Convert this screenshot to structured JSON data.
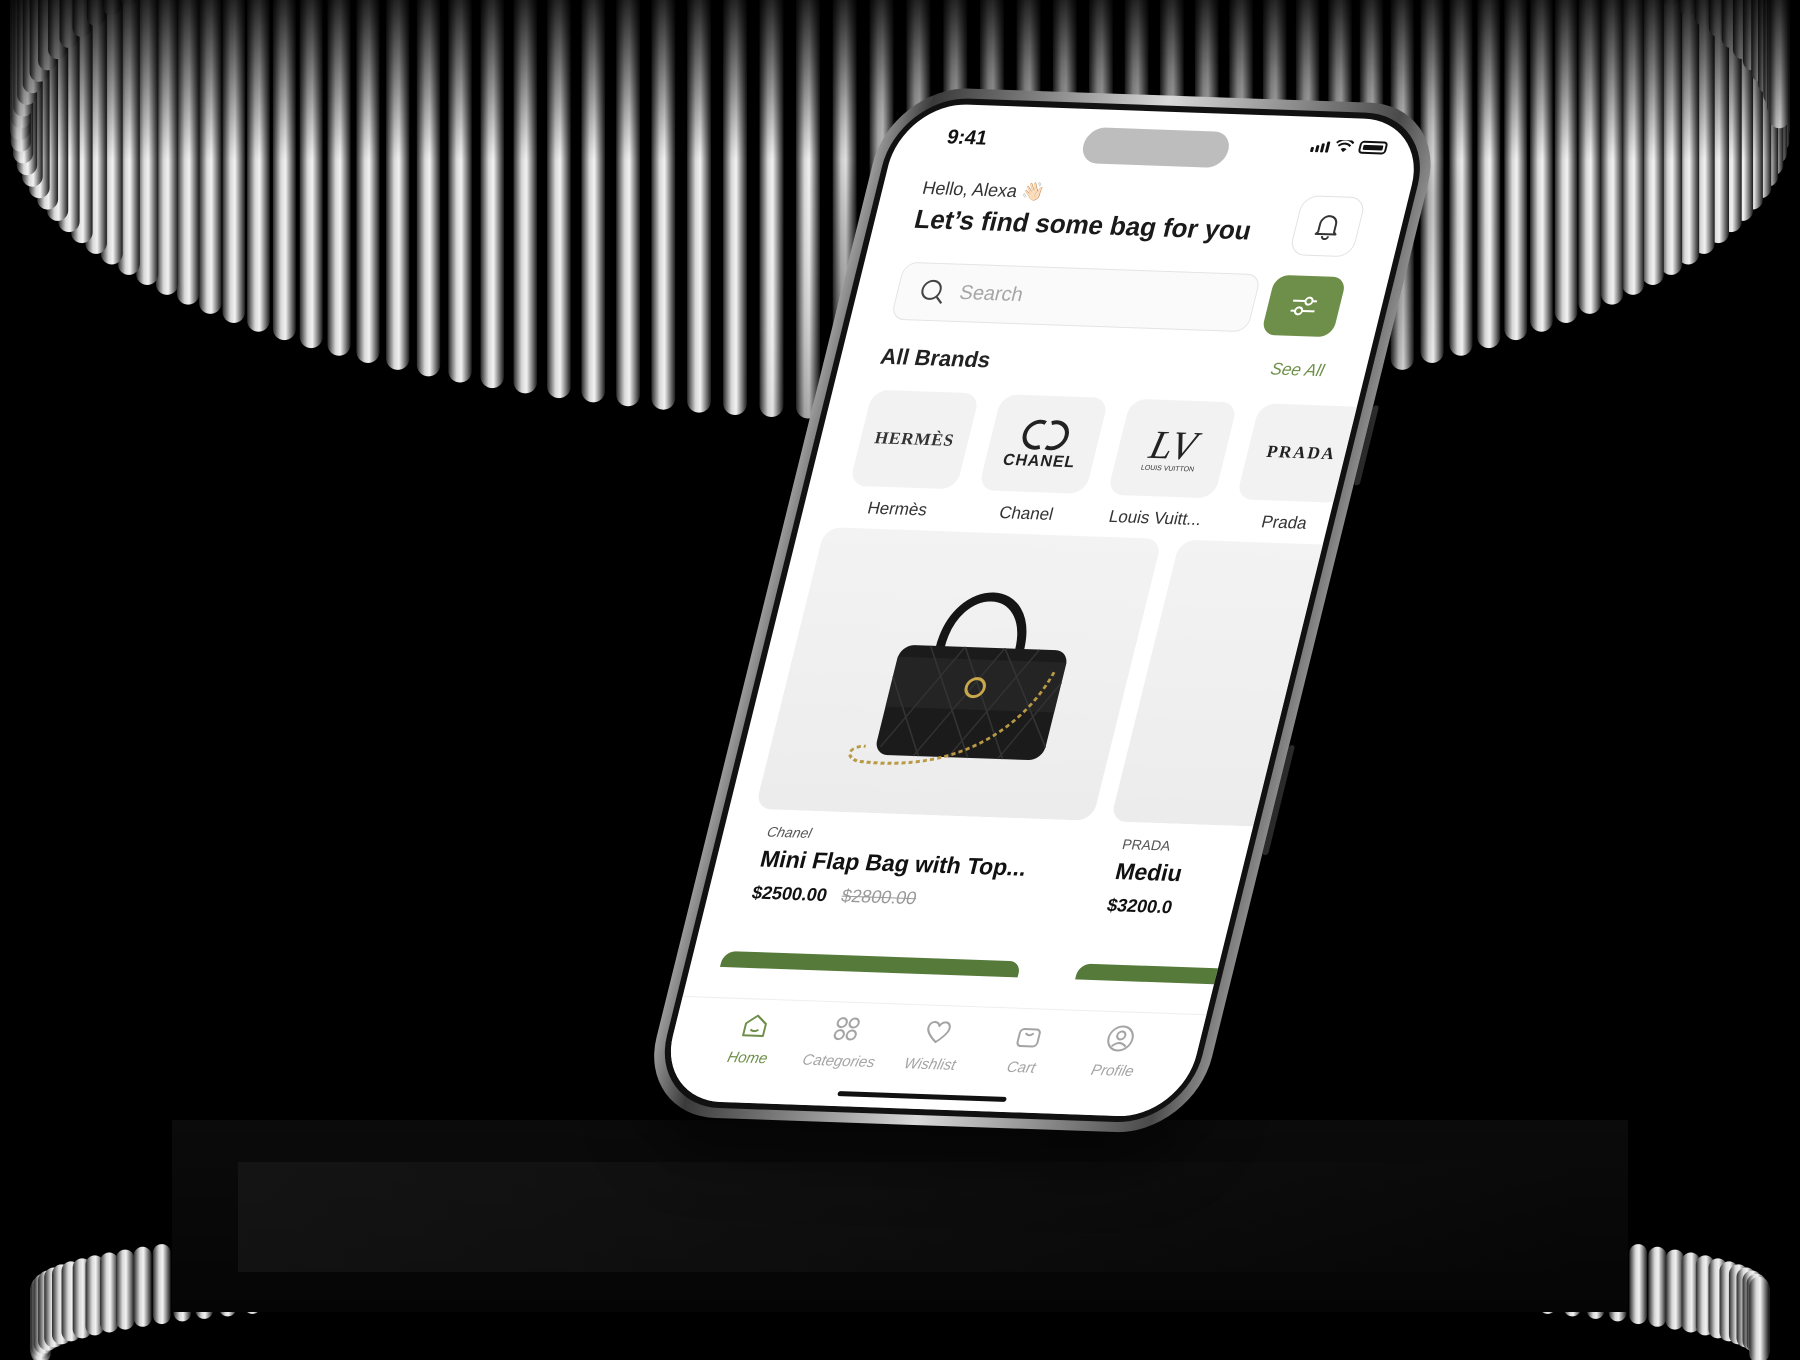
{
  "status_bar": {
    "time": "9:41"
  },
  "header": {
    "greeting": "Hello, Alexa 👋🏻",
    "headline": "Let’s find some bag for you"
  },
  "search": {
    "placeholder": "Search"
  },
  "brands_section": {
    "title": "All Brands",
    "see_all": "See All",
    "items": [
      {
        "name": "Hermès",
        "logo_text": "HERMÈS"
      },
      {
        "name": "Chanel",
        "logo_text": "CHANEL"
      },
      {
        "name": "Louis Vuitt...",
        "logo_text": "LV",
        "logo_subtext": "LOUIS VUITTON"
      },
      {
        "name": "Prada",
        "logo_text": "PRADA"
      }
    ]
  },
  "products": [
    {
      "brand": "Chanel",
      "name": "Mini Flap Bag with Top...",
      "price": "$2500.00",
      "old_price": "$2800.00"
    },
    {
      "brand": "PRADA",
      "name": "Mediu",
      "price": "$3200.0",
      "old_price": ""
    }
  ],
  "tabbar": {
    "items": [
      {
        "label": "Home",
        "icon": "home-icon",
        "active": true
      },
      {
        "label": "Categories",
        "icon": "categories-icon",
        "active": false
      },
      {
        "label": "Wishlist",
        "icon": "heart-icon",
        "active": false
      },
      {
        "label": "Cart",
        "icon": "bag-icon",
        "active": false
      },
      {
        "label": "Profile",
        "icon": "profile-icon",
        "active": false
      }
    ]
  },
  "colors": {
    "accent": "#6e8f49",
    "accent_dark": "#557a3a",
    "background": "#000000"
  }
}
